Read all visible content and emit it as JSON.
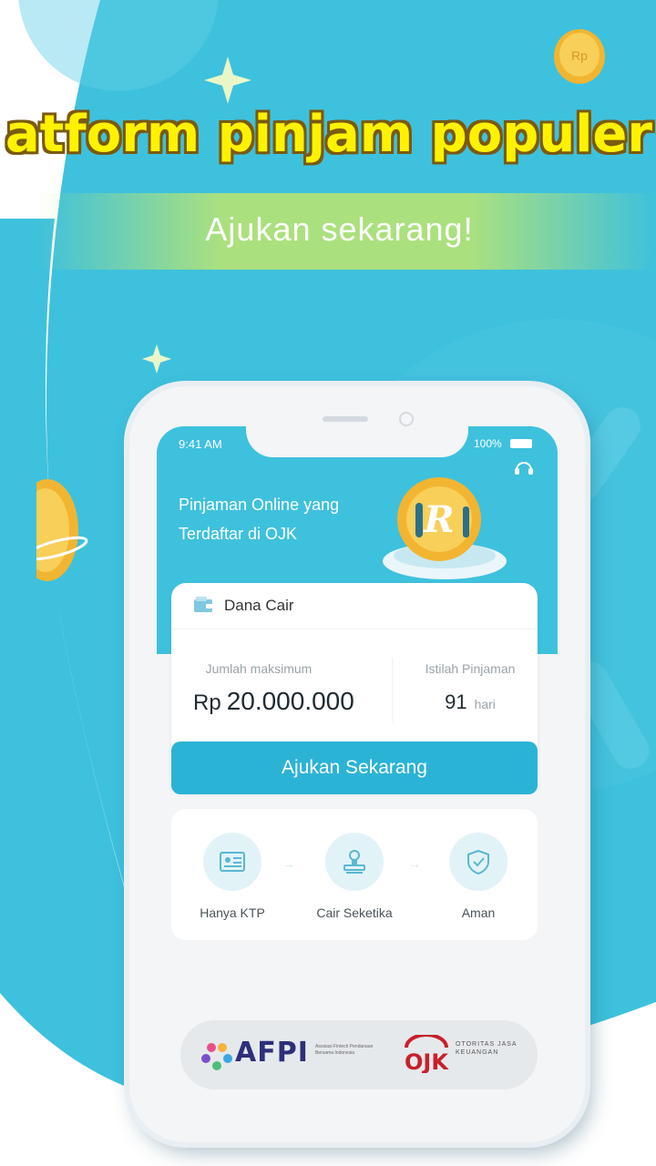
{
  "headline": "atform pinjam populer",
  "subtitle": "Ajukan sekarang!",
  "phone": {
    "status_time": "9:41 AM",
    "status_battery": "100%",
    "tagline_line1": "Pinjaman Online yang",
    "tagline_line2": "Terdaftar di OJK",
    "coin_badge_letter": "R",
    "card_title": "Dana Cair",
    "max_amount_label": "Jumlah maksimum",
    "currency": "Rp",
    "max_amount_value": "20.000.000",
    "tenor_label": "Istilah Pinjaman",
    "tenor_value": "91",
    "tenor_unit": "hari",
    "apply_button": "Ajukan Sekarang",
    "features": [
      {
        "label": "Hanya KTP",
        "icon": "id-card-icon"
      },
      {
        "label": "Cair Seketika",
        "icon": "stamp-icon"
      },
      {
        "label": "Aman",
        "icon": "shield-check-icon"
      }
    ],
    "footer": {
      "afpi_name": "AFPI",
      "afpi_full": "Asosiasi Fintech Pendanaan Bersama Indonesia",
      "ojk_name": "OJK",
      "ojk_full": "OTORITAS JASA KEUANGAN"
    }
  },
  "colors": {
    "background": "#3ec1dd",
    "headline_fill": "#fff200",
    "button": "#2bb3d6",
    "coin": "#f2b531"
  }
}
